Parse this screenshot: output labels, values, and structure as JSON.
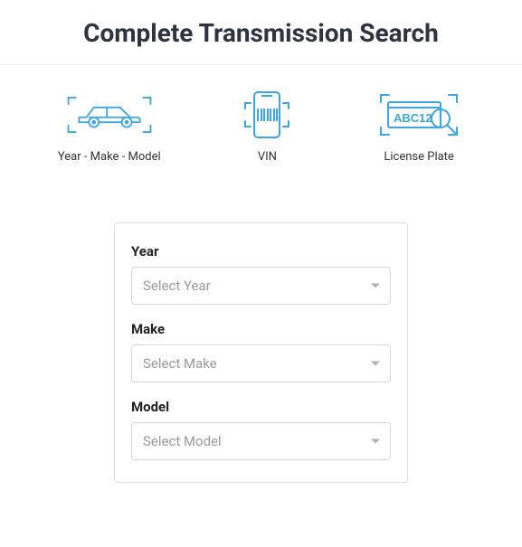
{
  "header": {
    "title": "Complete Transmission Search"
  },
  "tabs": [
    {
      "id": "ymm",
      "label": "Year - Make - Model",
      "icon": "car-icon"
    },
    {
      "id": "vin",
      "label": "VIN",
      "icon": "barcode-icon"
    },
    {
      "id": "plate",
      "label": "License Plate",
      "icon": "plate-icon"
    }
  ],
  "form": {
    "fields": [
      {
        "label": "Year",
        "placeholder": "Select Year"
      },
      {
        "label": "Make",
        "placeholder": "Select Make"
      },
      {
        "label": "Model",
        "placeholder": "Select Model"
      }
    ]
  },
  "colors": {
    "accent": "#3ea5e0"
  }
}
